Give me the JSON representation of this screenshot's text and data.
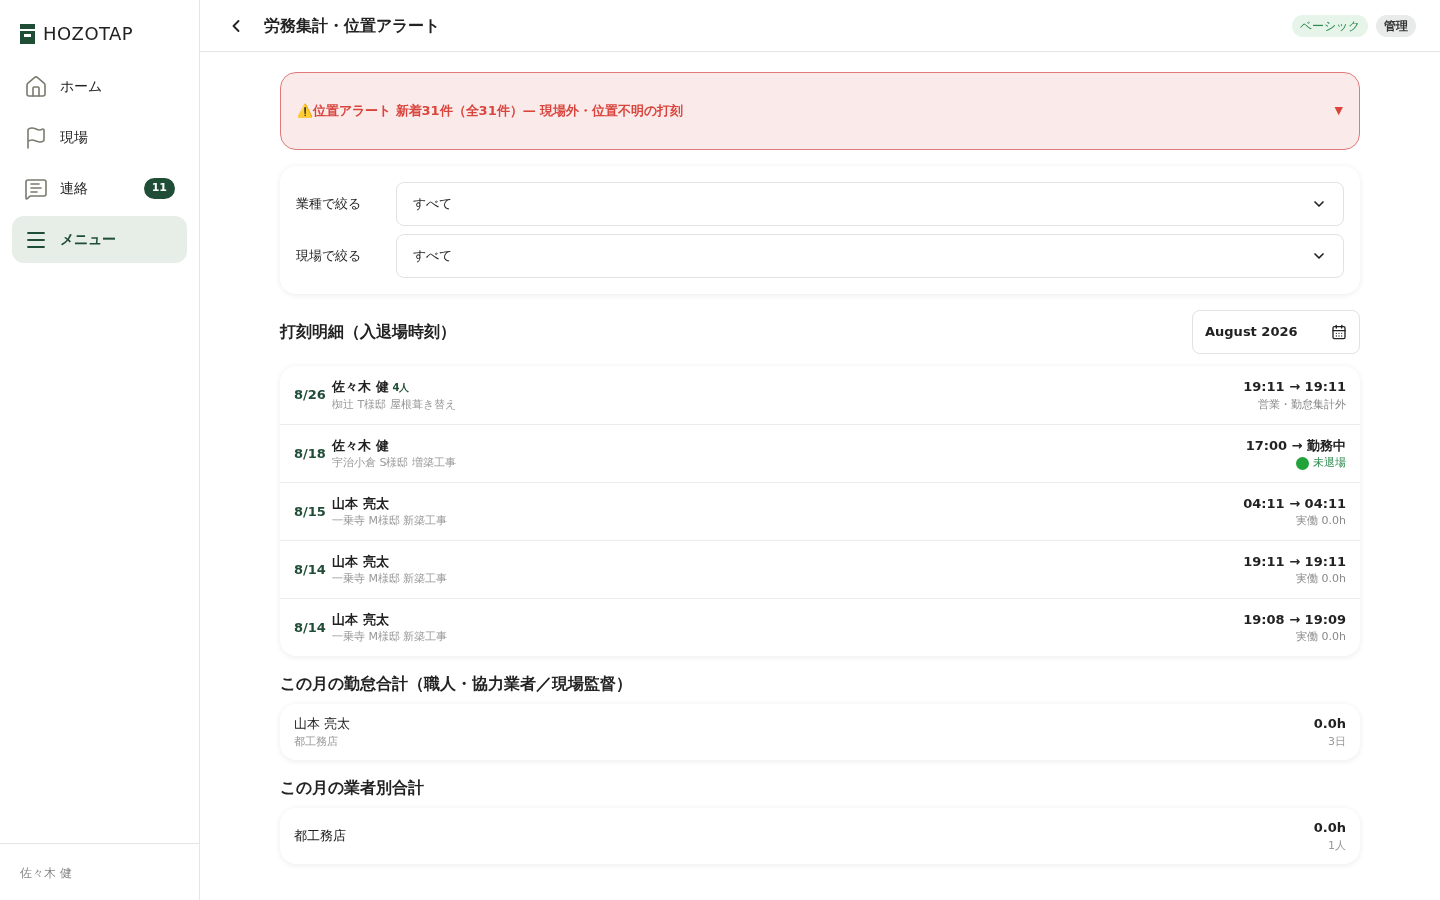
{
  "sidebar": {
    "logo": "HOZOTAP",
    "items": [
      {
        "label": "ホーム",
        "kind": "home",
        "selected": false
      },
      {
        "label": "現場",
        "kind": "site",
        "selected": false
      },
      {
        "label": "連絡",
        "kind": "messages",
        "selected": false,
        "badge": "11"
      },
      {
        "label": "メニュー",
        "kind": "menu",
        "selected": true
      }
    ],
    "user": "佐々木 健"
  },
  "header": {
    "title": "労務集計・位置アラート",
    "tags": [
      {
        "label": "ベーシック",
        "color": "#e6f4ea"
      },
      {
        "label": "管理",
        "color": "#e8ebe9"
      }
    ]
  },
  "alert": {
    "icon": "⚠️",
    "text": "位置アラート 新着31件（全31件）— 現場外・位置不明の打刻",
    "toggle": "▼",
    "expanded": false
  },
  "filters": [
    {
      "label": "業種で絞る",
      "value": "すべて"
    },
    {
      "label": "現場で絞る",
      "value": "すべて"
    }
  ],
  "punches": {
    "title": "打刻明細（入退場時刻）",
    "month": "August 2026",
    "rows": [
      {
        "date": "8/26",
        "name": "佐々木 健",
        "count": "4人",
        "site": "椥辻 T様邸 屋根葺き替え",
        "time": "19:11 → 19:11",
        "kind": "note",
        "status": "営業・勤怠集計外"
      },
      {
        "date": "8/18",
        "name": "佐々木 健",
        "site": "宇治小倉 S様邸 増築工事",
        "time": "17:00 → 勤務中",
        "kind": "on_site",
        "status": "未退場"
      },
      {
        "date": "8/15",
        "name": "山本 亮太",
        "site": "一乗寺 M様邸 新築工事",
        "time": "04:11 → 04:11",
        "kind": "note",
        "status": "実働 0.0h"
      },
      {
        "date": "8/14",
        "name": "山本 亮太",
        "site": "一乗寺 M様邸 新築工事",
        "time": "19:11 → 19:11",
        "kind": "note",
        "status": "実働 0.0h"
      },
      {
        "date": "8/14",
        "name": "山本 亮太",
        "site": "一乗寺 M様邸 新築工事",
        "time": "19:08 → 19:09",
        "kind": "note",
        "status": "実働 0.0h"
      }
    ]
  },
  "sections": [
    {
      "title": "この月の勤怠合計（職人・協力業者／現場監督）",
      "rows": [
        {
          "name": "山本 亮太",
          "sub": "都工務店",
          "total": "0.0h",
          "detail": "3日"
        }
      ]
    },
    {
      "title": "この月の業者別合計",
      "rows": [
        {
          "name": "都工務店",
          "total": "0.0h",
          "detail": "1人"
        }
      ]
    }
  ]
}
